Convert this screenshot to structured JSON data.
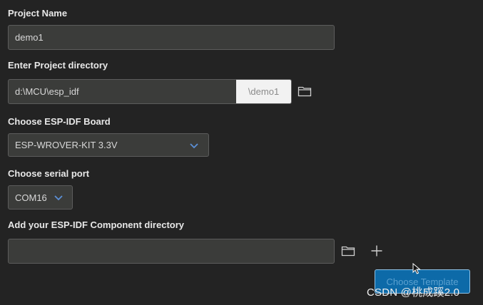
{
  "project_name": {
    "label": "Project Name",
    "value": "demo1"
  },
  "project_directory": {
    "label": "Enter Project directory",
    "value": "d:\\MCU\\esp_idf",
    "suffix": "\\demo1",
    "browse_icon": "folder-icon"
  },
  "board": {
    "label": "Choose ESP-IDF Board",
    "selected": "ESP-WROVER-KIT 3.3V",
    "icon": "chevron-down-icon"
  },
  "serial_port": {
    "label": "Choose serial port",
    "selected": "COM16",
    "icon": "chevron-down-icon"
  },
  "component_directory": {
    "label": "Add your ESP-IDF Component directory",
    "value": "",
    "browse_icon": "folder-icon",
    "add_icon": "plus-icon"
  },
  "choose_template_button": {
    "label": "Choose Template"
  },
  "watermark": "CSDN @桃成蹊2.0",
  "colors": {
    "background": "#232323",
    "field": "#3b3c3a",
    "accent": "#0d6aa8",
    "chevron": "#5b8fd6"
  }
}
